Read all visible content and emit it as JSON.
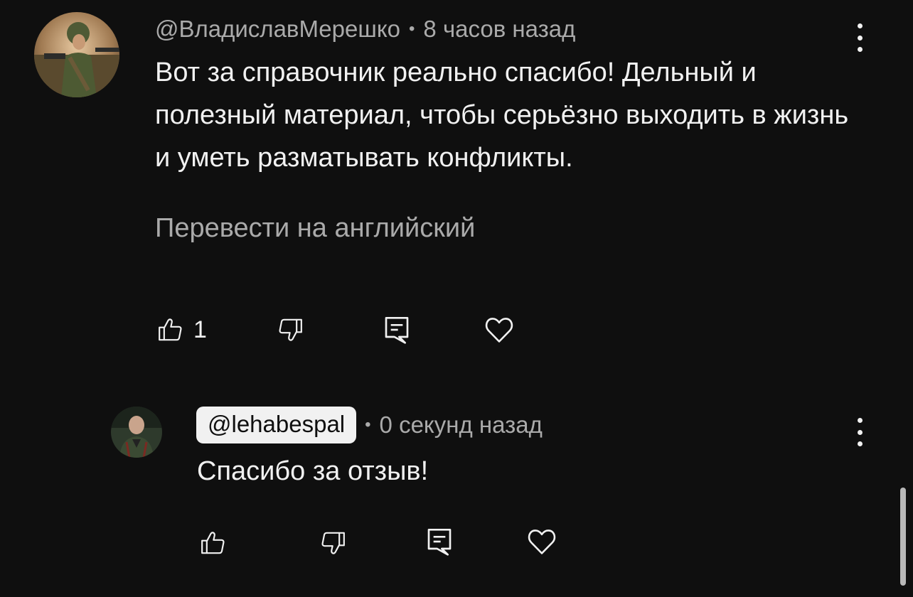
{
  "comments": [
    {
      "author": "@ВладиславМерешко",
      "separator": "•",
      "time": "8 часов назад",
      "text": "Вот за справочник реально спасибо! Дельный и полезный материал, чтобы серьёзно выходить в жизнь и уметь разматывать конфликты.",
      "translate_label": "Перевести на английский",
      "like_count": "1"
    }
  ],
  "reply": {
    "author": "@lehabespal",
    "separator": "•",
    "time": "0 секунд назад",
    "text": "Спасибо за отзыв!"
  },
  "icons": {
    "like": "thumb-up-icon",
    "dislike": "thumb-down-icon",
    "reply": "comment-icon",
    "heart": "heart-icon",
    "more": "kebab-menu-icon"
  },
  "colors": {
    "background": "#0f0f0f",
    "primary_text": "#f1f1f1",
    "secondary_text": "#aaaaaa",
    "icon": "#f1f1f1"
  }
}
